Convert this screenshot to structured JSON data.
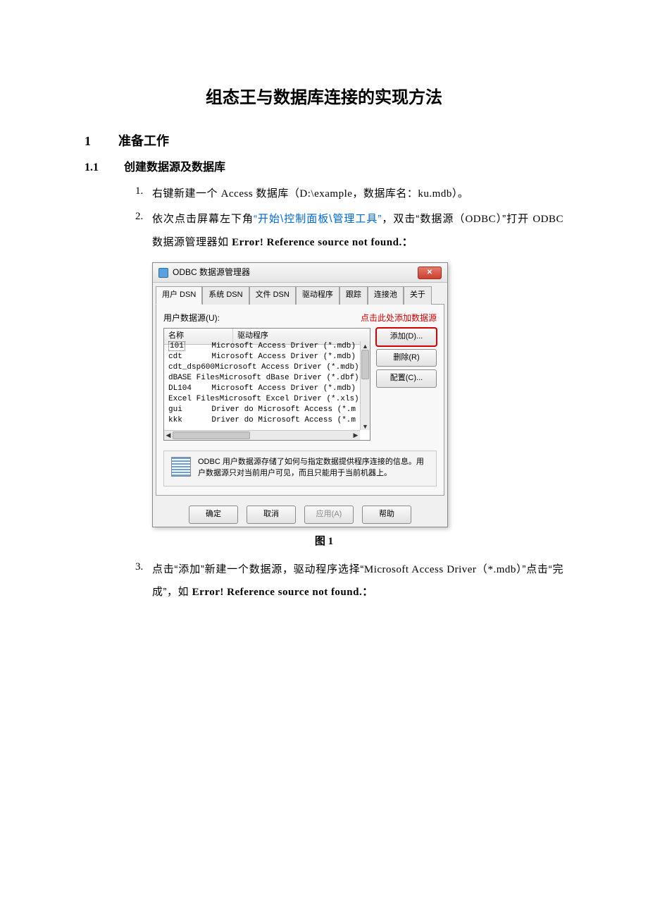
{
  "doc": {
    "title": "组态王与数据库连接的实现方法",
    "h1_num": "1",
    "h1_text": "准备工作",
    "h2_num": "1.1",
    "h2_text": "创建数据源及数据库",
    "step1_num": "1.",
    "step1_a": "右键新建一个 ",
    "step1_b": "Access ",
    "step1_c": "数据库（",
    "step1_d": "D:\\example",
    "step1_e": "，数据库名：",
    "step1_f": "ku.mdb",
    "step1_g": "）。",
    "step2_num": "2.",
    "step2_a": "依次点击屏幕左下角",
    "step2_b": "“开始\\控制面板\\管理工具”",
    "step2_c": "，双击“数据源（",
    "step2_d": "ODBC",
    "step2_e": "）”打开 ",
    "step2_f": "ODBC ",
    "step2_g": "数据源管理器如 ",
    "step2_err": "Error! Reference source not found.",
    "step2_colon": "：",
    "figure1_caption": "图 1",
    "step3_num": "3.",
    "step3_a": "点击“添加”新建一个数据源，驱动程序选择“",
    "step3_b": "Microsoft Access Driver",
    "step3_c": "（",
    "step3_d": "*.mdb",
    "step3_e": "）”点击“完成”，如 ",
    "step3_err": "Error! Reference source not found.",
    "step3_colon": "："
  },
  "dialog": {
    "title": "ODBC 数据源管理器",
    "close_glyph": "✕",
    "tabs": [
      "用户 DSN",
      "系统 DSN",
      "文件 DSN",
      "驱动程序",
      "跟踪",
      "连接池",
      "关于"
    ],
    "list_label": "用户数据源(U):",
    "red_tip": "点击此处添加数据源",
    "col_name": "名称",
    "col_driver": "驱动程序",
    "rows": [
      {
        "name": "101",
        "driver": "Microsoft Access Driver (*.mdb)"
      },
      {
        "name": "cdt",
        "driver": "Microsoft Access Driver (*.mdb)"
      },
      {
        "name": "cdt_dsp600",
        "driver": "Microsoft Access Driver (*.mdb)"
      },
      {
        "name": "dBASE Files",
        "driver": "Microsoft dBase Driver (*.dbf)"
      },
      {
        "name": "DL104",
        "driver": "Microsoft Access Driver (*.mdb)"
      },
      {
        "name": "Excel Files",
        "driver": "Microsoft Excel Driver (*.xls)"
      },
      {
        "name": "gui",
        "driver": "Driver do Microsoft Access (*.m"
      },
      {
        "name": "kkk",
        "driver": "Driver do Microsoft Access (*.m"
      }
    ],
    "btn_add": "添加(D)...",
    "btn_remove": "删除(R)",
    "btn_config": "配置(C)...",
    "info_text": "ODBC 用户数据源存储了如何与指定数据提供程序连接的信息。用户数据源只对当前用户可见，而且只能用于当前机器上。",
    "btn_ok": "确定",
    "btn_cancel": "取消",
    "btn_apply": "应用(A)",
    "btn_help": "帮助"
  }
}
